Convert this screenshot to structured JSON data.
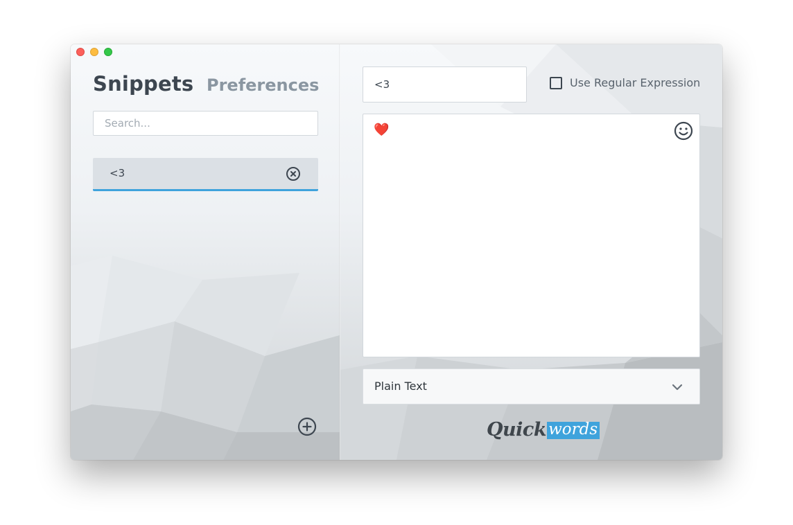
{
  "nav": {
    "snippets_tab": "Snippets",
    "preferences_tab": "Preferences"
  },
  "search": {
    "placeholder": "Search..."
  },
  "snippet_list": [
    {
      "label": "<3",
      "selected": true
    }
  ],
  "editor": {
    "abbreviation_value": "<3",
    "regex_label": "Use Regular Expression",
    "regex_checked": false,
    "content": "❤️",
    "format_value": "Plain Text"
  },
  "icons": {
    "remove": "close-circle-icon",
    "add": "plus-circle-icon",
    "emoji": "smiley-icon",
    "chevron": "chevron-down-icon"
  },
  "logo": {
    "part1": "Quick",
    "part2": "words"
  },
  "colors": {
    "accent": "#3fa3dc",
    "text_dark": "#3d4650",
    "text_muted": "#8a96a1",
    "selected_item_bg": "#dbe0e5",
    "heart": "#e0201c"
  }
}
